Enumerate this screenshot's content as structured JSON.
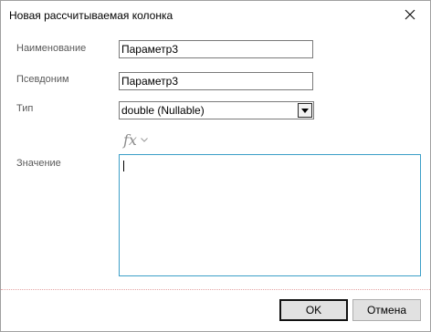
{
  "dialog": {
    "title": "Новая рассчитываемая колонка"
  },
  "form": {
    "name_label": "Наименование",
    "name_value": "Параметр3",
    "alias_label": "Псевдоним",
    "alias_value": "Параметр3",
    "type_label": "Тип",
    "type_value": "double (Nullable)",
    "formula_icon": "function-fx-icon",
    "value_label": "Значение",
    "value_text": ""
  },
  "buttons": {
    "ok_label": "OK",
    "cancel_label": "Отмена"
  },
  "colors": {
    "accent_focus_border": "#3c9fc8",
    "label_text": "#5a5a5a"
  }
}
